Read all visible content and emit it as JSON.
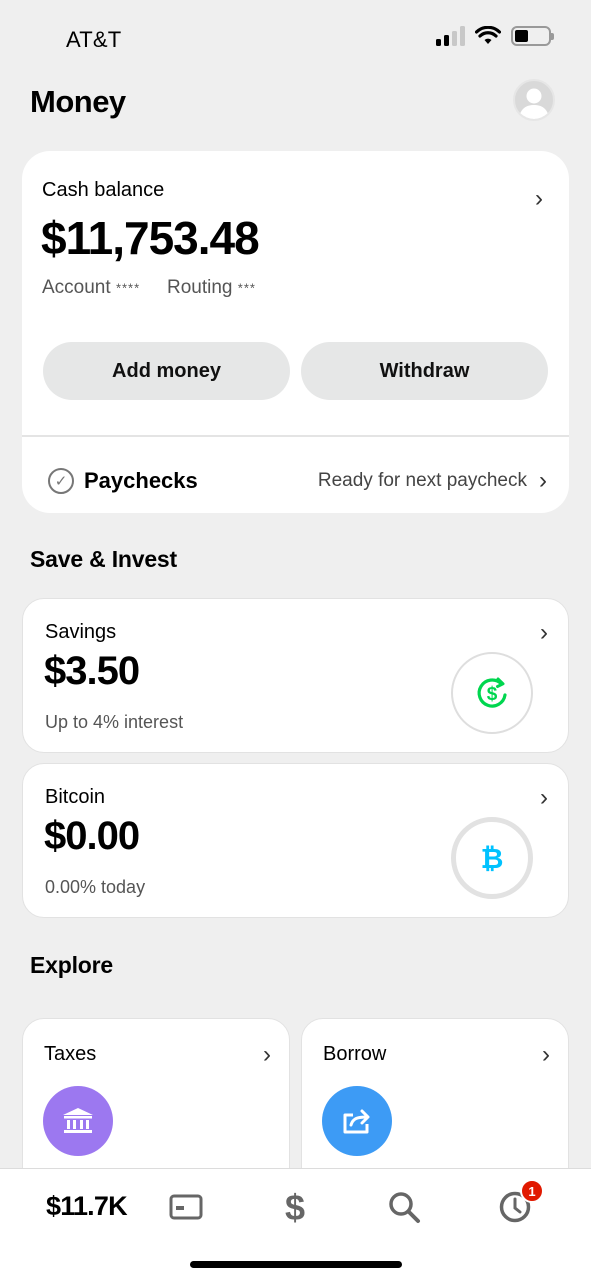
{
  "status_bar": {
    "carrier": "AT&T",
    "icons": [
      "signal-icon",
      "wifi-icon",
      "battery-icon"
    ]
  },
  "header": {
    "title": "Money",
    "avatar_icon": "avatar-icon"
  },
  "cash": {
    "label": "Cash balance",
    "amount": "$11,753.48",
    "account_label": "Account",
    "account_mask": "****",
    "routing_label": "Routing",
    "routing_mask": "***",
    "add_money_label": "Add money",
    "withdraw_label": "Withdraw",
    "paychecks_label": "Paychecks",
    "paychecks_status": "Ready for next paycheck"
  },
  "save_invest": {
    "section_title": "Save & Invest",
    "savings": {
      "label": "Savings",
      "amount": "$3.50",
      "subtitle": "Up to 4% interest",
      "icon": "dollar-savings-icon",
      "accent": "#00d64f"
    },
    "bitcoin": {
      "label": "Bitcoin",
      "amount": "$0.00",
      "subtitle": "0.00% today",
      "icon": "bitcoin-icon",
      "accent": "#00c2ff"
    }
  },
  "explore": {
    "section_title": "Explore",
    "tiles": [
      {
        "title": "Taxes",
        "icon": "bank-building-icon",
        "color": "#9c78f0"
      },
      {
        "title": "Borrow",
        "icon": "share-arrow-icon",
        "color": "#3d9bf5"
      }
    ]
  },
  "bottom_nav": {
    "balance": "$11.7K",
    "items": [
      "card-icon",
      "dollar-icon",
      "search-icon",
      "activity-clock-icon"
    ],
    "activity_badge": "1",
    "badge_color": "#e11900"
  }
}
